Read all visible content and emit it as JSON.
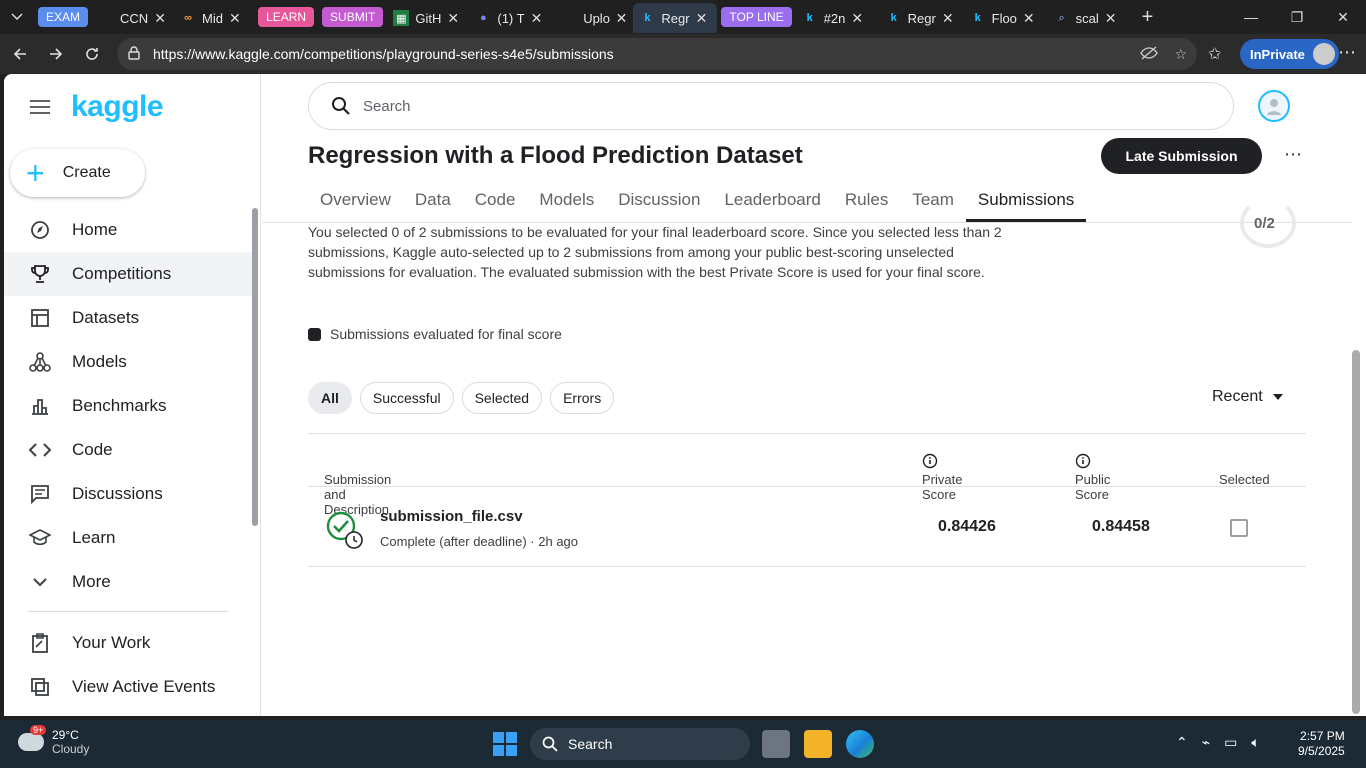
{
  "browser": {
    "tabs": [
      {
        "group": "EXAM",
        "group_color": "#5b8def",
        "title": "CCN"
      },
      {
        "title": "Mid"
      },
      {
        "group": "LEARN",
        "group_color": "#e8579a",
        "title": ""
      },
      {
        "group": "SUBMIT",
        "group_color": "#c45bd1",
        "title": "GitH"
      },
      {
        "title": "(1) T"
      },
      {
        "title": "Uplo"
      },
      {
        "title": "Regr",
        "active": true
      },
      {
        "group": "TOP LINE",
        "group_color": "#9b6ef0",
        "title": "#2n"
      },
      {
        "title": "Regr"
      },
      {
        "title": "Floo"
      },
      {
        "title": "scal"
      }
    ],
    "url": "https://www.kaggle.com/competitions/playground-series-s4e5/submissions",
    "inprivate_label": "InPrivate"
  },
  "sidebar": {
    "logo": "kaggle",
    "create_label": "Create",
    "items": [
      {
        "label": "Home",
        "icon": "compass-icon"
      },
      {
        "label": "Competitions",
        "icon": "trophy-icon",
        "active": true
      },
      {
        "label": "Datasets",
        "icon": "table-icon"
      },
      {
        "label": "Models",
        "icon": "models-icon"
      },
      {
        "label": "Benchmarks",
        "icon": "bar-chart-icon"
      },
      {
        "label": "Code",
        "icon": "code-icon"
      },
      {
        "label": "Discussions",
        "icon": "discussion-icon"
      },
      {
        "label": "Learn",
        "icon": "school-icon"
      },
      {
        "label": "More",
        "icon": "chevron-down-icon"
      }
    ],
    "bottom_items": [
      {
        "label": "Your Work",
        "icon": "clipboard-icon"
      },
      {
        "label": "View Active Events",
        "icon": "events-icon"
      }
    ]
  },
  "header": {
    "search_placeholder": "Search"
  },
  "competition": {
    "title": "Regression with a Flood Prediction Dataset",
    "late_submission_label": "Late Submission",
    "tabs": [
      "Overview",
      "Data",
      "Code",
      "Models",
      "Discussion",
      "Leaderboard",
      "Rules",
      "Team",
      "Submissions"
    ],
    "active_tab": "Submissions"
  },
  "submissions": {
    "intro": "You selected 0 of 2 submissions to be evaluated for your final leaderboard score. Since you selected less than 2 submissions, Kaggle auto-selected up to 2 submissions from among your public best-scoring unselected submissions for evaluation. The evaluated submission with the best Private Score is used for your final score.",
    "ring_label": "0/2",
    "legend": "Submissions evaluated for final score",
    "filters": [
      "All",
      "Successful",
      "Selected",
      "Errors"
    ],
    "active_filter": "All",
    "sort_label": "Recent",
    "columns": {
      "description": "Submission and Description",
      "private": "Private Score",
      "public": "Public Score",
      "selected": "Selected"
    },
    "rows": [
      {
        "file": "submission_file.csv",
        "status": "Complete (after deadline) · 2h ago",
        "private": "0.84426",
        "public": "0.84458",
        "selected": false
      }
    ]
  },
  "taskbar": {
    "temperature": "29°C",
    "weather": "Cloudy",
    "weather_badge": "9+",
    "search_label": "Search",
    "time": "2:57 PM",
    "date": "9/5/2025"
  }
}
